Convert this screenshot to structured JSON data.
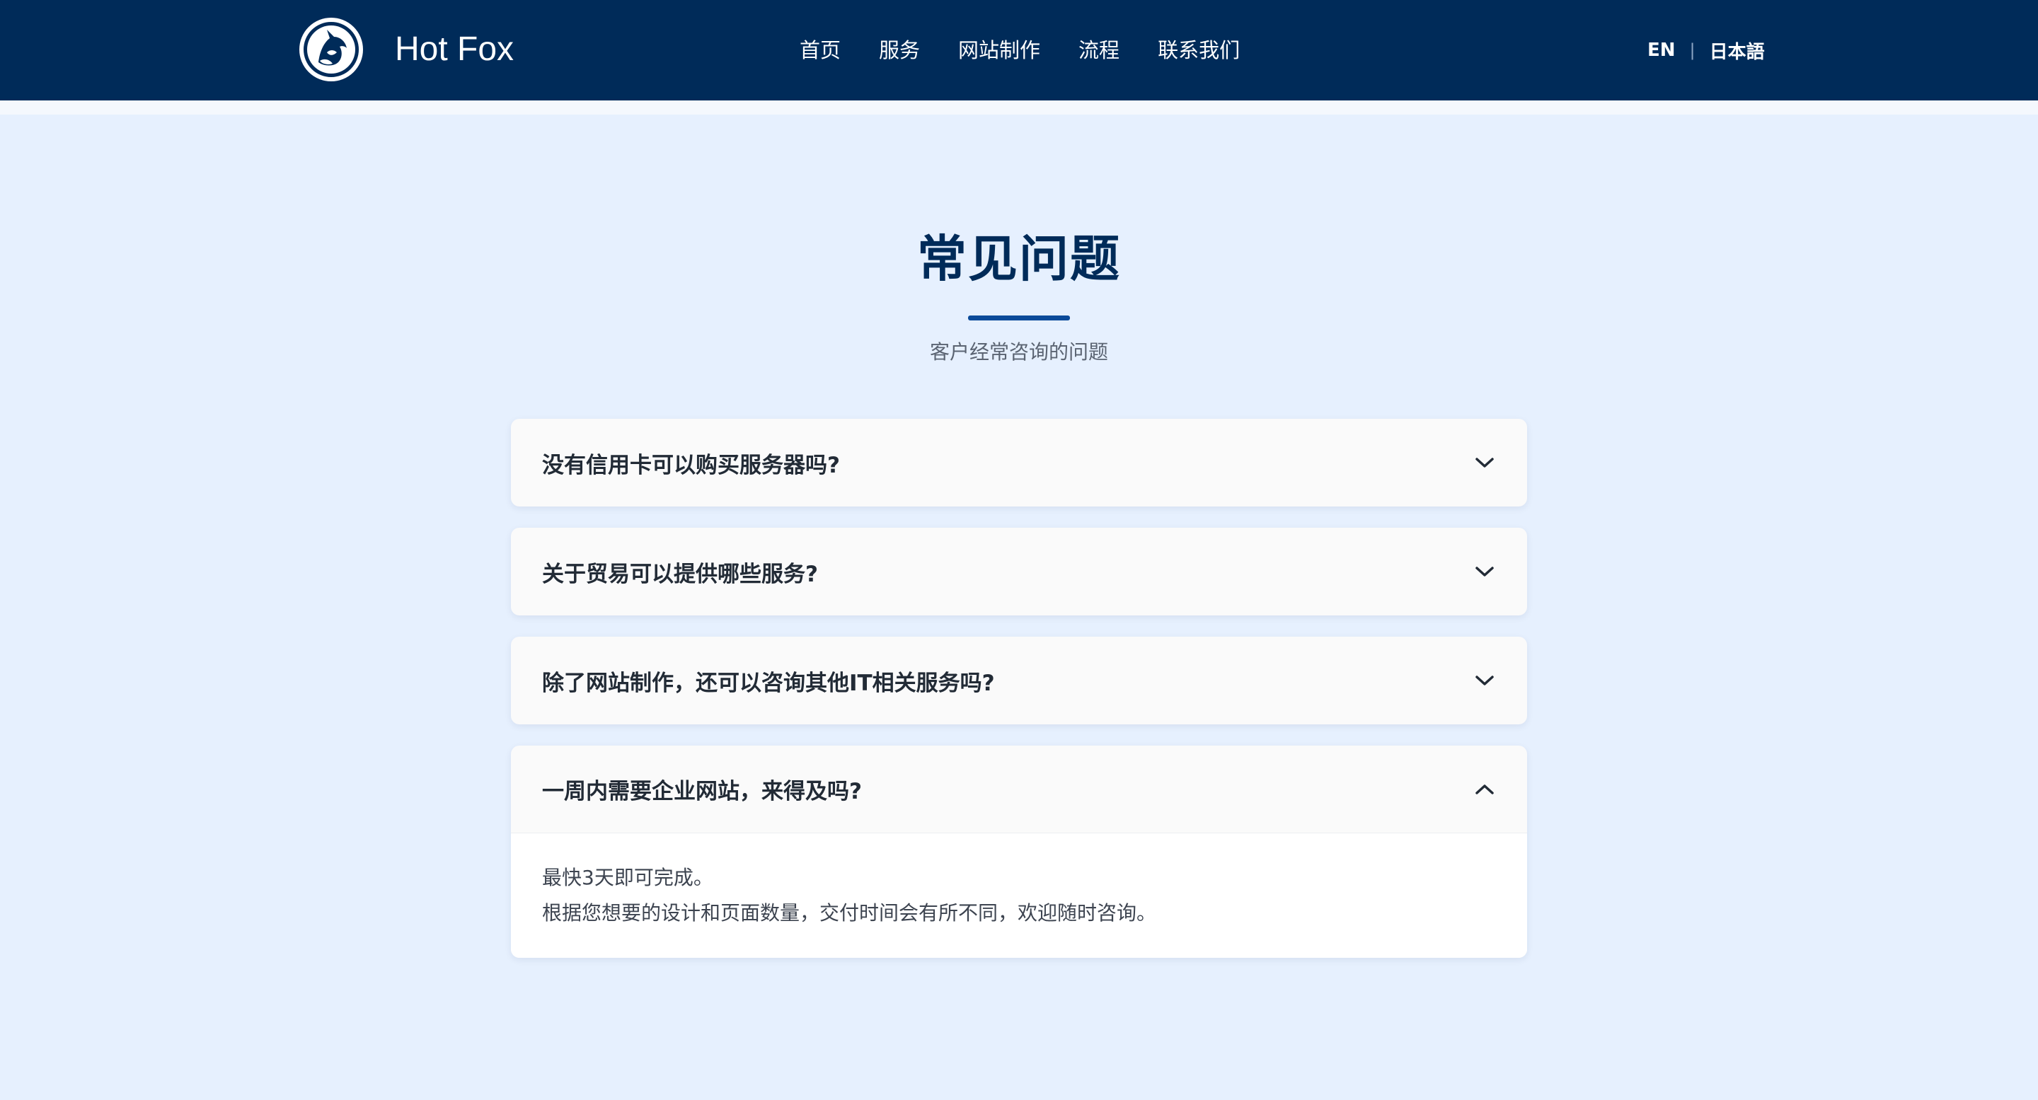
{
  "header": {
    "brand": "Hot Fox",
    "nav": [
      {
        "label": "首页"
      },
      {
        "label": "服务"
      },
      {
        "label": "网站制作"
      },
      {
        "label": "流程"
      },
      {
        "label": "联系我们"
      }
    ],
    "lang": {
      "en": "EN",
      "separator": "|",
      "ja": "日本語"
    }
  },
  "faq": {
    "title": "常见问题",
    "subtitle": "客户经常咨询的问题",
    "items": [
      {
        "question": "没有信用卡可以购买服务器吗?",
        "open": false
      },
      {
        "question": "关于贸易可以提供哪些服务?",
        "open": false
      },
      {
        "question": "除了网站制作，还可以咨询其他IT相关服务吗?",
        "open": false
      },
      {
        "question": "一周内需要企业网站，来得及吗?",
        "open": true,
        "answer_line1": "最快3天即可完成。",
        "answer_line2": "根据您想要的设计和页面数量，交付时间会有所不同，欢迎随时咨询。"
      }
    ]
  },
  "icons": {
    "logo": "fox-logo-icon",
    "collapsed": "chevron-down-icon",
    "expanded": "chevron-up-icon"
  },
  "colors": {
    "header_bg": "#002b59",
    "page_bg": "#e6f0fe",
    "accent": "#0a4a99"
  }
}
